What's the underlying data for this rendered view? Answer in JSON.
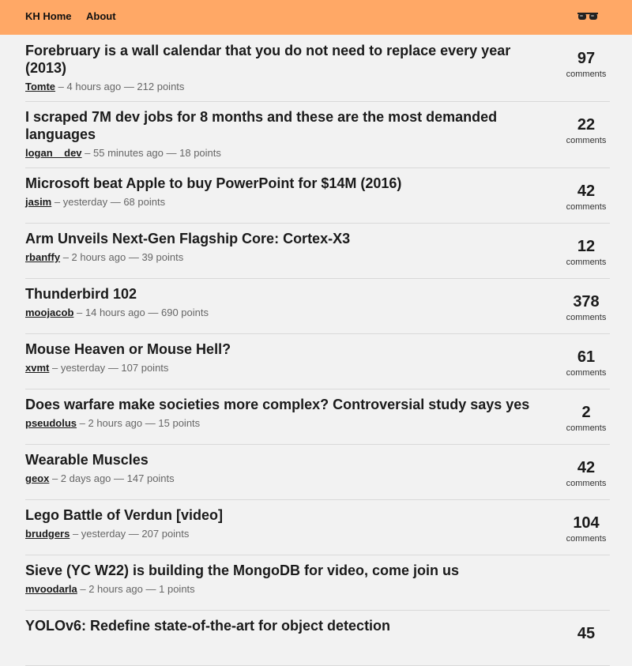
{
  "nav": {
    "home": "KH Home",
    "about": "About",
    "icon": "glasses-icon"
  },
  "comments_label": "comments",
  "stories": [
    {
      "title": "Forebruary is a wall calendar that you do not need to replace every year (2013)",
      "user": "Tomte",
      "time": "– 4 hours ago",
      "points": "— 212 points",
      "comments": "97"
    },
    {
      "title": "I scraped 7M dev jobs for 8 months and these are the most demanded languages",
      "user": "logan__dev",
      "time": "– 55 minutes ago",
      "points": "— 18 points",
      "comments": "22"
    },
    {
      "title": "Microsoft beat Apple to buy PowerPoint for $14M (2016)",
      "user": "jasim",
      "time": "– yesterday",
      "points": "— 68 points",
      "comments": "42"
    },
    {
      "title": "Arm Unveils Next-Gen Flagship Core: Cortex-X3",
      "user": "rbanffy",
      "time": "– 2 hours ago",
      "points": "— 39 points",
      "comments": "12"
    },
    {
      "title": "Thunderbird 102",
      "user": "moojacob",
      "time": "– 14 hours ago",
      "points": "— 690 points",
      "comments": "378"
    },
    {
      "title": "Mouse Heaven or Mouse Hell?",
      "user": "xvmt",
      "time": "– yesterday",
      "points": "— 107 points",
      "comments": "61"
    },
    {
      "title": "Does warfare make societies more complex? Controversial study says yes",
      "user": "pseudolus",
      "time": "– 2 hours ago",
      "points": "— 15 points",
      "comments": "2"
    },
    {
      "title": "Wearable Muscles",
      "user": "geox",
      "time": "– 2 days ago",
      "points": "— 147 points",
      "comments": "42"
    },
    {
      "title": "Lego Battle of Verdun [video]",
      "user": "brudgers",
      "time": "– yesterday",
      "points": "— 207 points",
      "comments": "104"
    },
    {
      "title": "Sieve (YC W22) is building the MongoDB for video, come join us",
      "user": "mvoodarla",
      "time": "– 2 hours ago",
      "points": "— 1 points",
      "comments": ""
    },
    {
      "title": "YOLOv6: Redefine state-of-the-art for object detection",
      "user": "",
      "time": "",
      "points": "",
      "comments": "45"
    }
  ]
}
